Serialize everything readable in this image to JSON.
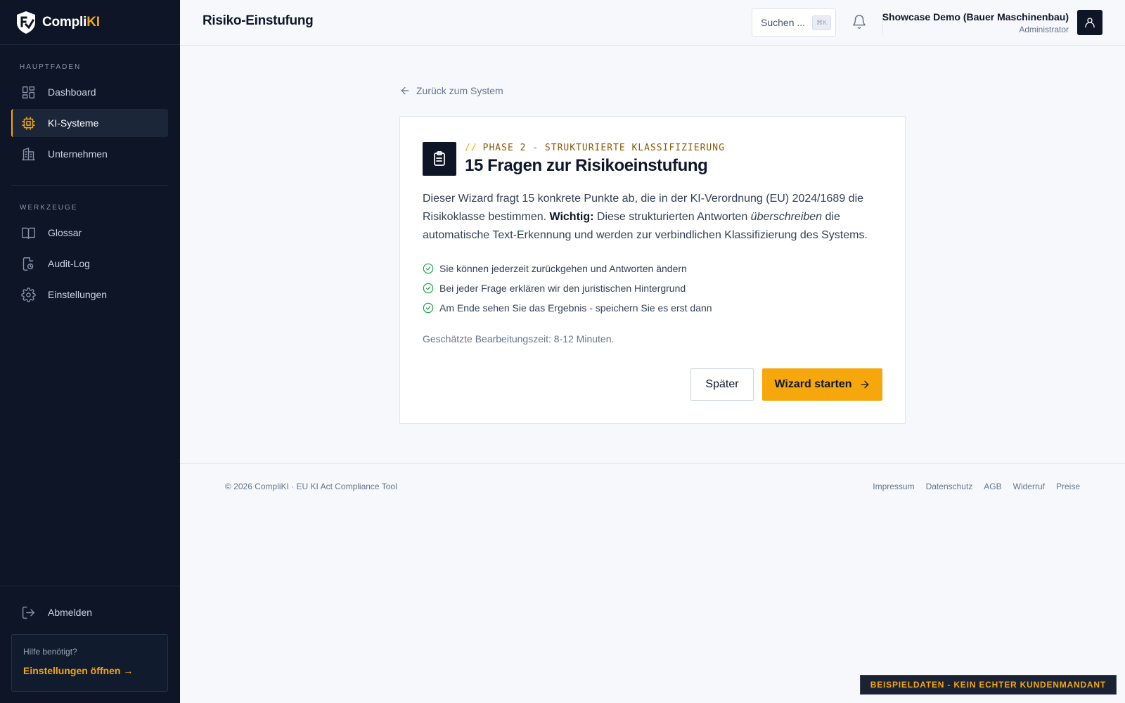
{
  "app": {
    "brand_prefix": "Compli",
    "brand_accent": "KI",
    "accent_color": "#f5a70c",
    "sidebar_bg": "#0d1526"
  },
  "sidebar": {
    "section_main": "Hauptfaden",
    "section_tools": "Werkzeuge",
    "items": [
      {
        "label": "Dashboard",
        "icon": "dashboard-icon",
        "active": false
      },
      {
        "label": "KI-Systeme",
        "icon": "chip-icon",
        "active": true
      },
      {
        "label": "Unternehmen",
        "icon": "building-icon",
        "active": false
      },
      {
        "label": "Glossar",
        "icon": "book-icon",
        "active": false
      },
      {
        "label": "Audit-Log",
        "icon": "audit-icon",
        "active": false
      },
      {
        "label": "Einstellungen",
        "icon": "gear-icon",
        "active": false
      }
    ],
    "logout_label": "Abmelden",
    "help": {
      "label": "Hilfe benötigt?",
      "link": "Einstellungen öffnen →"
    }
  },
  "header": {
    "title": "Risiko-Einstufung",
    "search_placeholder": "Suchen ...",
    "search_shortcut": "⌘K",
    "user_name": "Showcase Demo (Bauer Maschinenbau)",
    "user_role": "Administrator"
  },
  "main": {
    "back_label": "Zurück zum System",
    "card": {
      "eyebrow_slashes": "//",
      "eyebrow": "PHASE 2 - STRUKTURIERTE KLASSIFIZIERUNG",
      "title": "15 Fragen zur Risikoeinstufung",
      "desc_part1": "Dieser Wizard fragt 15 konkrete Punkte ab, die in der KI-Verordnung (EU) 2024/1689 die Risikoklasse bestimmen. ",
      "desc_bold": "Wichtig:",
      "desc_part2": " Diese strukturierten Antworten ",
      "desc_italic": "überschreiben",
      "desc_part3": " die automatische Text-Erkennung und werden zur verbindlichen Klassifizierung des Systems.",
      "checklist": [
        "Sie können jederzeit zurückgehen und Antworten ändern",
        "Bei jeder Frage erklären wir den juristischen Hintergrund",
        "Am Ende sehen Sie das Ergebnis - speichern Sie es erst dann"
      ],
      "estimate": "Geschätzte Bearbeitungszeit: 8-12 Minuten.",
      "btn_later": "Später",
      "btn_start": "Wizard starten"
    }
  },
  "footer": {
    "copyright": "© 2026 CompliKI · EU KI Act Compliance Tool",
    "links": [
      "Impressum",
      "Datenschutz",
      "AGB",
      "Widerruf",
      "Preise"
    ]
  },
  "demo_badge": "Beispieldaten - kein echter Kundenmandant"
}
